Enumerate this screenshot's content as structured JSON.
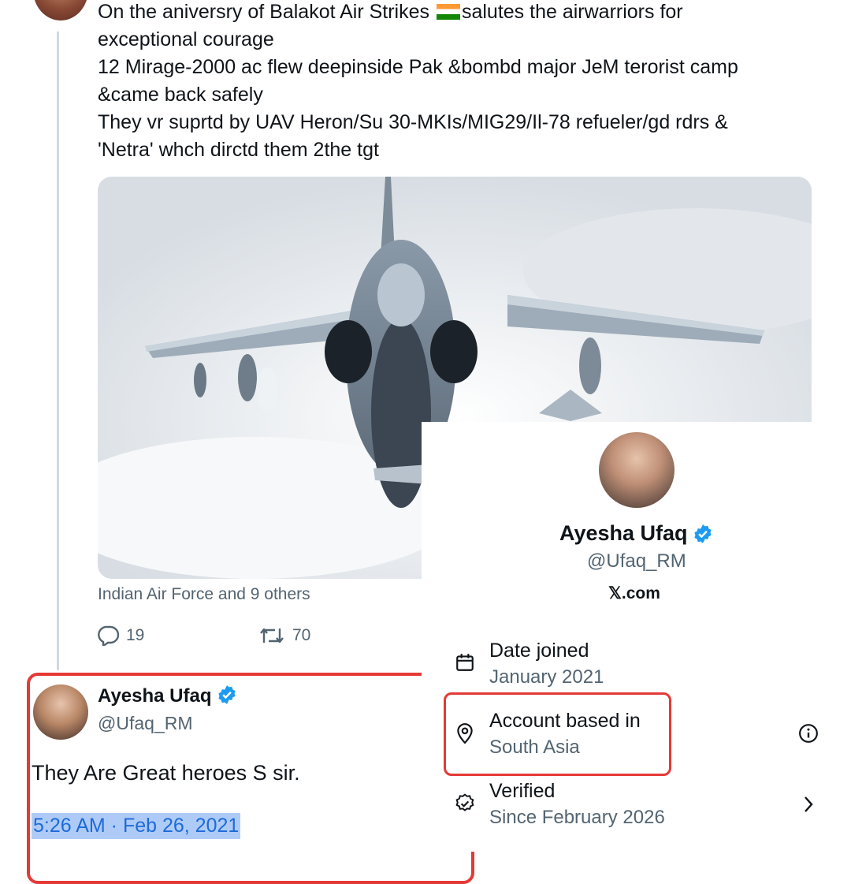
{
  "tweet": {
    "lines": [
      "On the aniversry of Balakot Air Strikes",
      "salutes the airwarriors for",
      "exceptional courage",
      "12 Mirage-2000 ac flew deepinside Pak &bombd major JeM terorist camp",
      "&came back safely",
      "They vr suprtd by UAV Heron/Su 30-MKIs/MIG29/Il-78 refueler/gd rdrs &",
      "'Netra' whch dirctd them 2the tgt"
    ],
    "tagged": "Indian Air Force and 9 others",
    "replies": "19",
    "retweets": "70"
  },
  "reply": {
    "name": "Ayesha Ufaq",
    "handle": "@Ufaq_RM",
    "text": "They Are  Great heroes S sir.",
    "timestamp": "5:26 AM · Feb 26, 2021"
  },
  "about": {
    "name": "Ayesha Ufaq",
    "handle": "@Ufaq_RM",
    "site_x": "𝕏",
    "site_rest": ".com",
    "rows": [
      {
        "title": "Date joined",
        "value": "January 2021",
        "icon": "calendar-icon"
      },
      {
        "title": "Account based in",
        "value": "South Asia",
        "icon": "location-pin-icon"
      },
      {
        "title": "Verified",
        "value": "Since February 2026",
        "icon": "verified-outline-icon"
      }
    ]
  },
  "colors": {
    "verified": "#1d9bf0",
    "highlight": "#e53935",
    "secondary": "#536471"
  }
}
